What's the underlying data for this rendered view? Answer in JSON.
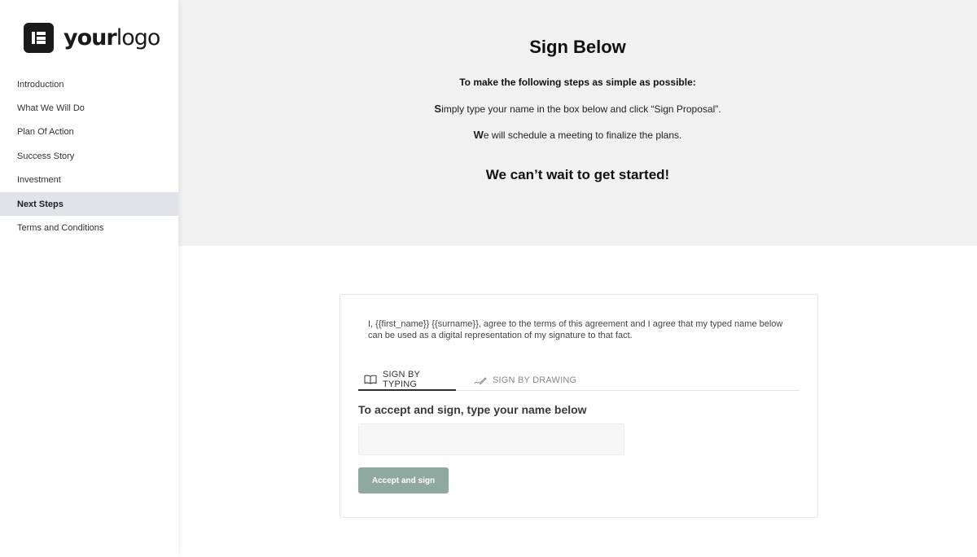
{
  "logo": {
    "text_bold": "your",
    "text_regular": "logo",
    "icon": "elementor-icon"
  },
  "sidebar": {
    "items": [
      {
        "label": "Introduction",
        "active": false
      },
      {
        "label": "What We Will Do",
        "active": false
      },
      {
        "label": "Plan Of Action",
        "active": false
      },
      {
        "label": "Success Story",
        "active": false
      },
      {
        "label": "Investment",
        "active": false
      },
      {
        "label": "Next Steps",
        "active": true
      },
      {
        "label": "Terms and Conditions",
        "active": false
      }
    ]
  },
  "hero": {
    "title": "Sign Below",
    "intro": "To make the following steps as simple as possible:",
    "step1_first": "S",
    "step1_rest": "imply type your name in the box below and click “Sign Proposal”.",
    "step2_first": "W",
    "step2_rest": "e will schedule a meeting to finalize the plans.",
    "closing": "We can’t wait to get started!"
  },
  "signature": {
    "agreement": "I, {{first_name}} {{surname}}, agree to the terms of this agreement and I agree that my typed name below can be used as a digital representation of my signature to that fact.",
    "tabs": [
      {
        "label": "SIGN BY TYPING",
        "icon": "book-icon",
        "active": true
      },
      {
        "label": "SIGN BY DRAWING",
        "icon": "pen-signature-icon",
        "active": false
      }
    ],
    "label": "To accept and sign, type your name below",
    "input_value": "",
    "input_placeholder": "",
    "button_label": "Accept and sign"
  },
  "colors": {
    "hero_bg": "#f1f1f1",
    "active_nav_bg": "#e1e3e9",
    "button_bg": "#8fa9a1"
  }
}
